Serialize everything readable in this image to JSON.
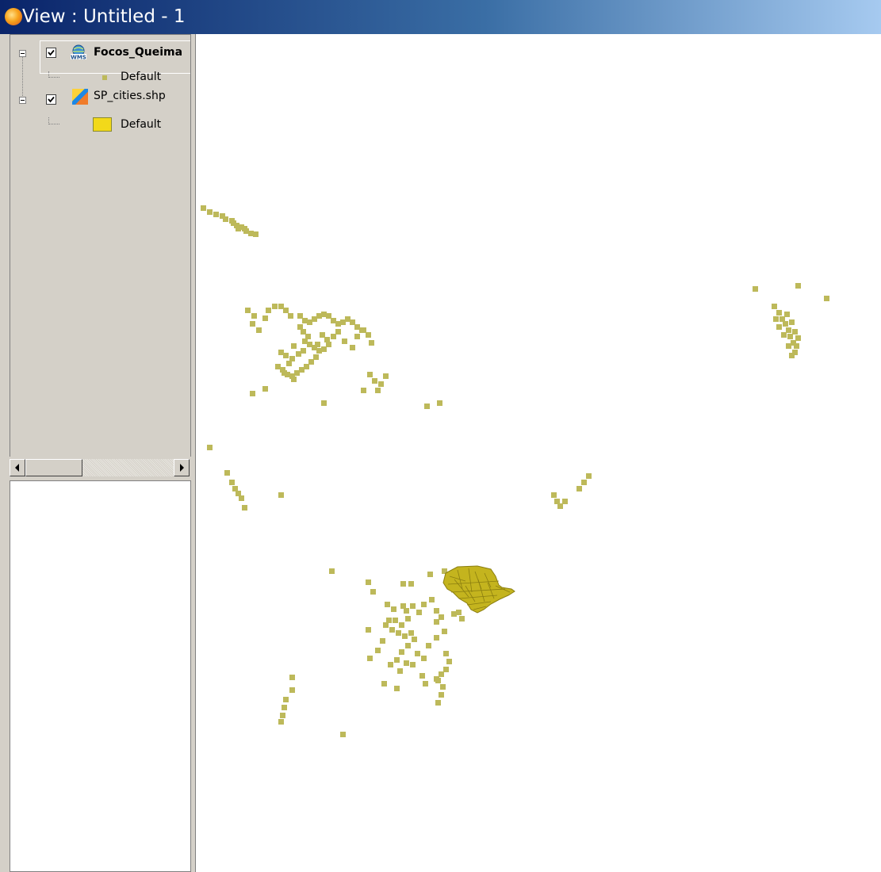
{
  "window": {
    "title": "View : Untitled - 1",
    "app_icon": "gvsig-globe-icon"
  },
  "toc": {
    "layers": [
      {
        "name": "Focos_Queima",
        "type": "WMS",
        "icon": "wms-layer-icon",
        "visible": true,
        "expanded": true,
        "legend": [
          {
            "label": "Default",
            "symbol": "point",
            "color": "#bdb95a"
          }
        ]
      },
      {
        "name": "SP_cities.shp",
        "type": "shapefile",
        "icon": "shapefile-layer-icon",
        "visible": true,
        "expanded": true,
        "legend": [
          {
            "label": "Default",
            "symbol": "polygon",
            "color": "#f2d91a"
          }
        ]
      }
    ]
  },
  "colors": {
    "fire_point": "#bdb95a",
    "sp_polygon_fill": "#c4b41e",
    "sp_polygon_stroke": "#8a7e10"
  }
}
